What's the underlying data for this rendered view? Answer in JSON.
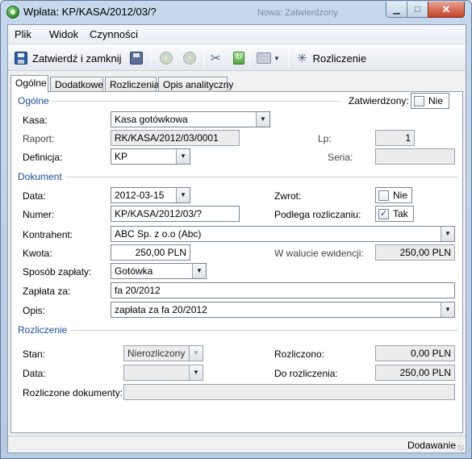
{
  "window": {
    "title": "Wpłata: KP/KASA/2012/03/?",
    "background_title": "Nowa: Zatwierdzony",
    "min_glyph": "▁",
    "max_glyph": "□",
    "close_glyph": "✕"
  },
  "menu": {
    "plik": "Plik",
    "widok": "Widok",
    "czynnosci": "Czynności"
  },
  "toolbar": {
    "save_close": "Zatwierdź i zamknij",
    "rozliczenie": "Rozliczenie",
    "icons": [
      "save-icon",
      "save-copy-icon",
      "back-icon",
      "forward-icon",
      "tools-icon",
      "refresh-icon",
      "print-icon",
      "settle-icon"
    ]
  },
  "tabs": [
    "Ogólne",
    "Dodatkowe",
    "Rozliczenia",
    "Opis analityczny"
  ],
  "sections": {
    "ogolne": "Ogólne",
    "dokument": "Dokument",
    "rozliczenie": "Rozliczenie"
  },
  "ogolne": {
    "zatwierdzony_label": "Zatwierdzony:",
    "zatwierdzony_value": "Nie",
    "kasa_label": "Kasa:",
    "kasa_value": "Kasa gotówkowa",
    "raport_label": "Raport:",
    "raport_value": "RK/KASA/2012/03/0001",
    "lp_label": "Lp:",
    "lp_value": "1",
    "definicja_label": "Definicja:",
    "definicja_value": "KP",
    "seria_label": "Seria:",
    "seria_value": ""
  },
  "dokument": {
    "data_label": "Data:",
    "data_value": "2012-03-15",
    "zwrot_label": "Zwrot:",
    "zwrot_value": "Nie",
    "numer_label": "Numer:",
    "numer_value": "KP/KASA/2012/03/?",
    "podlega_label": "Podlega rozliczaniu:",
    "podlega_value": "Tak",
    "kontrahent_label": "Kontrahent:",
    "kontrahent_value": "ABC Sp. z o.o (Abc)",
    "kwota_label": "Kwota:",
    "kwota_value": "250,00 PLN",
    "waluta_label": "W walucie ewidencji:",
    "waluta_value": "250,00 PLN",
    "sposob_label": "Sposób zapłaty:",
    "sposob_value": "Gotówka",
    "zaplata_label": "Zapłata za:",
    "zaplata_value": "fa 20/2012",
    "opis_label": "Opis:",
    "opis_value": "zapłata za fa 20/2012"
  },
  "rozliczenie": {
    "stan_label": "Stan:",
    "stan_value": "Nierozliczony",
    "rozliczono_label": "Rozliczono:",
    "rozliczono_value": "0,00 PLN",
    "data_label": "Data:",
    "data_value": "",
    "do_rozliczenia_label": "Do rozliczenia:",
    "do_rozliczenia_value": "250,00 PLN",
    "dokumenty_label": "Rozliczone dokumenty:",
    "dokumenty_value": ""
  },
  "status": {
    "mode": "Dodawanie"
  }
}
